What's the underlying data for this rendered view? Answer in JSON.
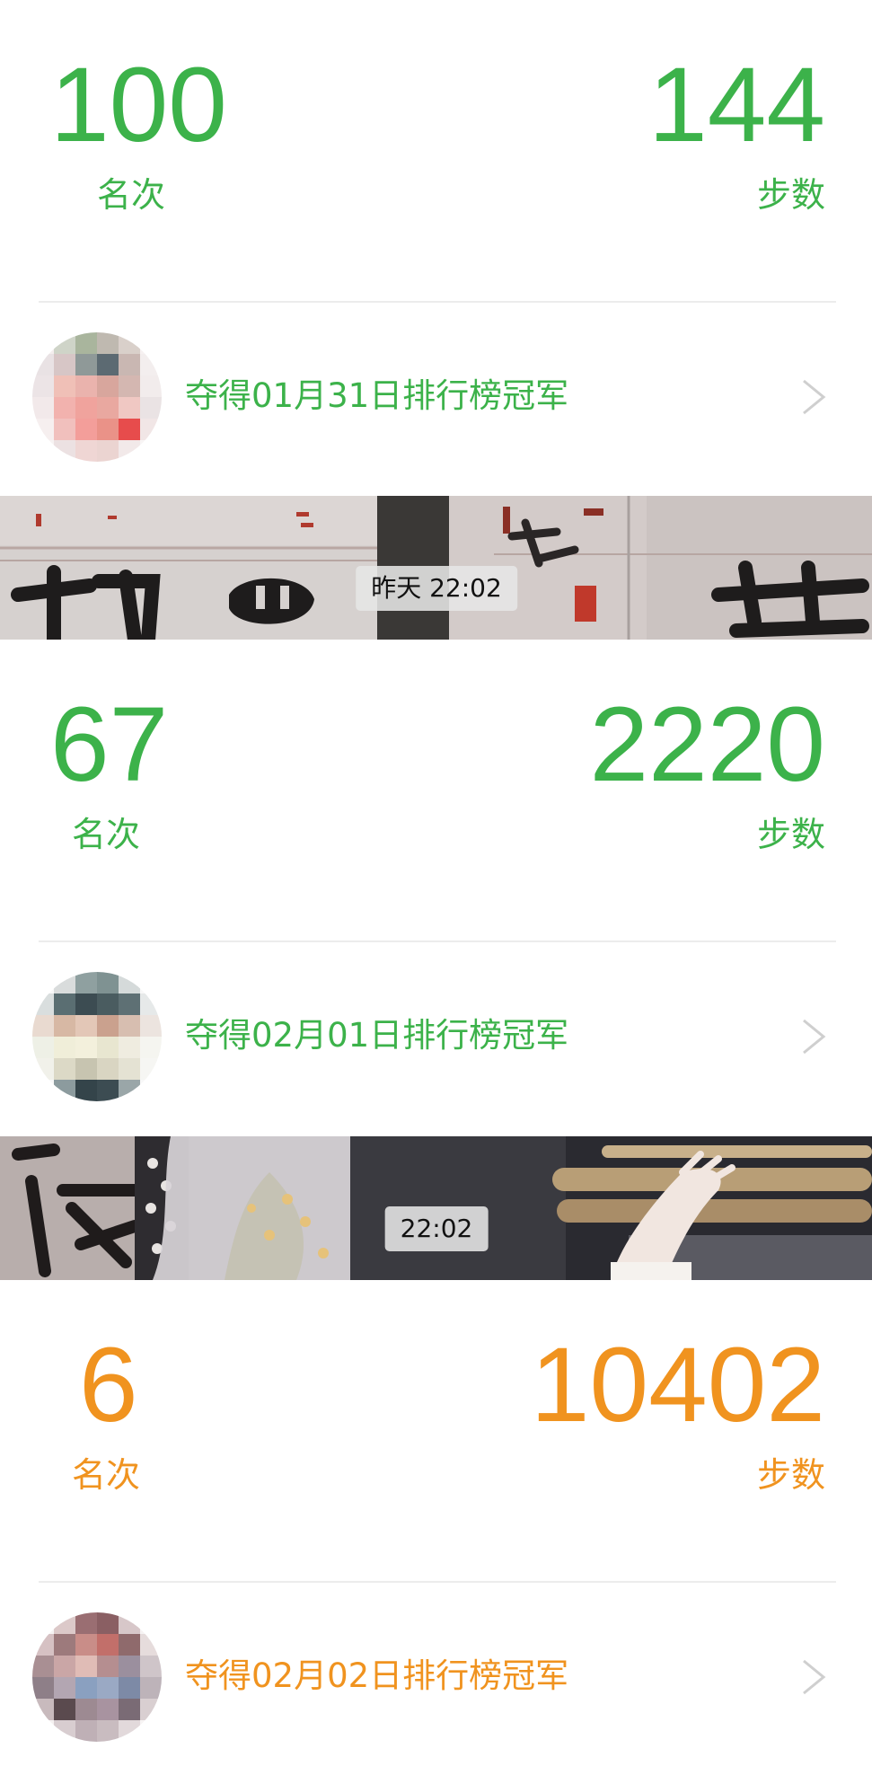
{
  "colors": {
    "green": "#3cb24a",
    "orange": "#f0931f",
    "chevron": "#cfcfcf"
  },
  "cards": [
    {
      "rank": "100",
      "rank_label": "名次",
      "steps": "144",
      "steps_label": "步数",
      "champion_text": "夺得01月31日排行榜冠军",
      "avatar_icon": "blurred-avatar-1",
      "chevron_icon": "chevron-right-icon"
    },
    {
      "rank": "67",
      "rank_label": "名次",
      "steps": "2220",
      "steps_label": "步数",
      "champion_text": "夺得02月01日排行榜冠军",
      "avatar_icon": "blurred-avatar-2",
      "chevron_icon": "chevron-right-icon"
    },
    {
      "rank": "6",
      "rank_label": "名次",
      "steps": "10402",
      "steps_label": "步数",
      "champion_text": "夺得02月02日排行榜冠军",
      "avatar_icon": "blurred-avatar-3",
      "chevron_icon": "chevron-right-icon"
    }
  ],
  "timestamps": [
    "昨天 22:02",
    "22:02"
  ]
}
